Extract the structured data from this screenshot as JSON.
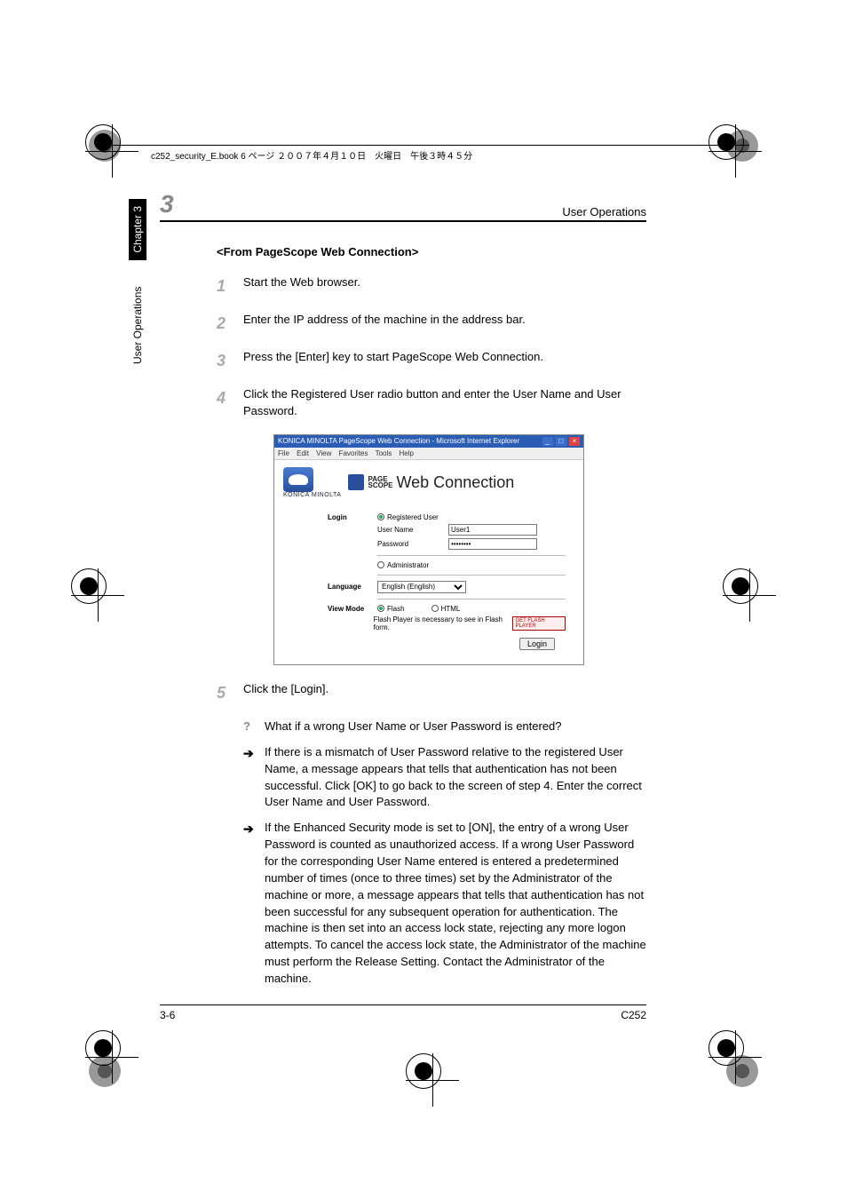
{
  "header_runner": "c252_security_E.book  6 ページ  ２００７年４月１０日　火曜日　午後３時４５分",
  "section": {
    "number": "3",
    "title": "User Operations"
  },
  "sidetab": {
    "chapter": "Chapter 3",
    "label": "User Operations"
  },
  "footer": {
    "left": "3-6",
    "right": "C252"
  },
  "subhead": "<From PageScope Web Connection>",
  "steps": {
    "s1": {
      "num": "1",
      "text": "Start the Web browser."
    },
    "s2": {
      "num": "2",
      "text": "Enter the IP address of the machine in the address bar."
    },
    "s3": {
      "num": "3",
      "text": "Press the [Enter] key to start PageScope Web Connection."
    },
    "s4": {
      "num": "4",
      "text": "Click the Registered User radio button and enter the User Name and User Password."
    },
    "s5": {
      "num": "5",
      "text": "Click the [Login]."
    }
  },
  "qa": {
    "q": "What if a wrong User Name or User Password is entered?",
    "a1": "If there is a mismatch of User Password relative to the registered User Name, a message appears that tells that authentication has not been successful. Click [OK] to go back to the screen of step 4. Enter the correct User Name and User Password.",
    "a2": "If the Enhanced Security mode is set to [ON], the entry of a wrong User Password is counted as unauthorized access. If a wrong User Password for the corresponding User Name entered is entered a predetermined number of times (once to three times) set by the Administrator of the machine or more, a message appears that tells that authentication has not been successful for any subsequent operation for authentication. The machine is then set into an access lock state, rejecting any more logon attempts. To cancel the access lock state, the Administrator of the machine must perform the Release Setting. Contact the Administrator of the machine."
  },
  "screenshot": {
    "title": "KONICA MINOLTA PageScope Web Connection - Microsoft Internet Explorer",
    "menus": [
      "File",
      "Edit",
      "View",
      "Favorites",
      "Tools",
      "Help"
    ],
    "brand": "KONICA MINOLTA",
    "banner_small1": "PAGE",
    "banner_small2": "SCOPE",
    "banner_big": "Web Connection",
    "login_label": "Login",
    "registered_user": "Registered User",
    "administrator": "Administrator",
    "username_label": "User Name",
    "username_value": "User1",
    "password_label": "Password",
    "password_value": "••••••••",
    "language_label": "Language",
    "language_value": "English (English)",
    "viewmode_label": "View Mode",
    "viewmode_flash": "Flash",
    "viewmode_html": "HTML",
    "flash_note": "Flash Player is necessary to see in Flash form.",
    "flash_badge": "GET FLASH PLAYER",
    "login_button": "Login"
  }
}
